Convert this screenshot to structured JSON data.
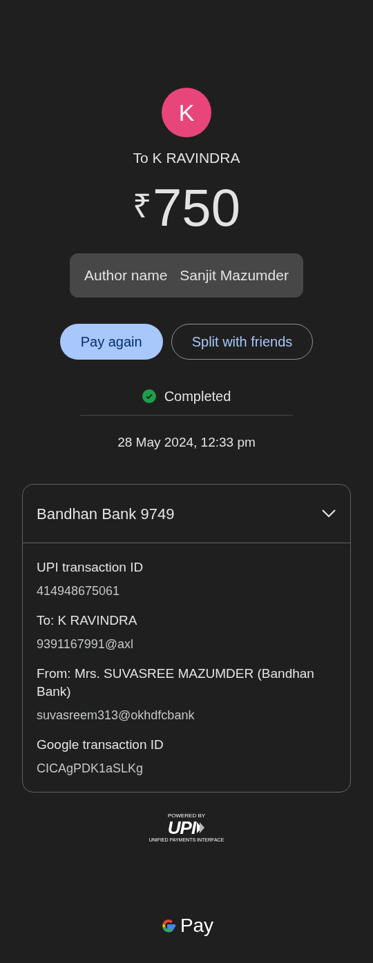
{
  "recipient": {
    "avatar_letter": "K",
    "title": "To K RAVINDRA"
  },
  "amount": {
    "currency": "₹",
    "value": "750"
  },
  "note": {
    "label": "Author name",
    "value": "Sanjit Mazumder"
  },
  "actions": [
    {
      "label": "Pay again",
      "kind": "filled"
    },
    {
      "label": "Split with friends",
      "kind": "outlined"
    }
  ],
  "status": {
    "label": "Completed"
  },
  "date": "28 May 2024, 12:33 pm",
  "details": {
    "account": "Bandhan Bank 9749",
    "expanded": true,
    "items": [
      {
        "label": "UPI transaction ID",
        "value": "414948675061"
      },
      {
        "label": "To: K RAVINDRA",
        "value": "9391167991@axl"
      },
      {
        "label": "From: Mrs. SUVASREE MAZUMDER (Bandhan Bank)",
        "value": "suvasreem313@okhdfcbank"
      },
      {
        "label": "Google transaction ID",
        "value": "CICAgPDK1aSLKg"
      }
    ]
  },
  "upi_logo": {
    "top": "POWERED BY",
    "mark": "UPI",
    "bottom": "UNIFIED PAYMENTS INTERFACE"
  },
  "brand": {
    "label": "Pay"
  }
}
